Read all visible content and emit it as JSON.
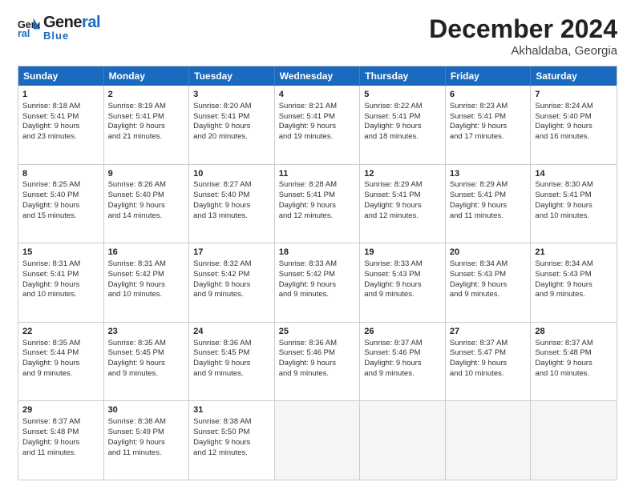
{
  "header": {
    "logo_line1": "General",
    "logo_line2": "Blue",
    "month_title": "December 2024",
    "location": "Akhaldaba, Georgia"
  },
  "days_of_week": [
    "Sunday",
    "Monday",
    "Tuesday",
    "Wednesday",
    "Thursday",
    "Friday",
    "Saturday"
  ],
  "weeks": [
    [
      {
        "day": "1",
        "lines": [
          "Sunrise: 8:18 AM",
          "Sunset: 5:41 PM",
          "Daylight: 9 hours",
          "and 23 minutes."
        ]
      },
      {
        "day": "2",
        "lines": [
          "Sunrise: 8:19 AM",
          "Sunset: 5:41 PM",
          "Daylight: 9 hours",
          "and 21 minutes."
        ]
      },
      {
        "day": "3",
        "lines": [
          "Sunrise: 8:20 AM",
          "Sunset: 5:41 PM",
          "Daylight: 9 hours",
          "and 20 minutes."
        ]
      },
      {
        "day": "4",
        "lines": [
          "Sunrise: 8:21 AM",
          "Sunset: 5:41 PM",
          "Daylight: 9 hours",
          "and 19 minutes."
        ]
      },
      {
        "day": "5",
        "lines": [
          "Sunrise: 8:22 AM",
          "Sunset: 5:41 PM",
          "Daylight: 9 hours",
          "and 18 minutes."
        ]
      },
      {
        "day": "6",
        "lines": [
          "Sunrise: 8:23 AM",
          "Sunset: 5:41 PM",
          "Daylight: 9 hours",
          "and 17 minutes."
        ]
      },
      {
        "day": "7",
        "lines": [
          "Sunrise: 8:24 AM",
          "Sunset: 5:40 PM",
          "Daylight: 9 hours",
          "and 16 minutes."
        ]
      }
    ],
    [
      {
        "day": "8",
        "lines": [
          "Sunrise: 8:25 AM",
          "Sunset: 5:40 PM",
          "Daylight: 9 hours",
          "and 15 minutes."
        ]
      },
      {
        "day": "9",
        "lines": [
          "Sunrise: 8:26 AM",
          "Sunset: 5:40 PM",
          "Daylight: 9 hours",
          "and 14 minutes."
        ]
      },
      {
        "day": "10",
        "lines": [
          "Sunrise: 8:27 AM",
          "Sunset: 5:40 PM",
          "Daylight: 9 hours",
          "and 13 minutes."
        ]
      },
      {
        "day": "11",
        "lines": [
          "Sunrise: 8:28 AM",
          "Sunset: 5:41 PM",
          "Daylight: 9 hours",
          "and 12 minutes."
        ]
      },
      {
        "day": "12",
        "lines": [
          "Sunrise: 8:29 AM",
          "Sunset: 5:41 PM",
          "Daylight: 9 hours",
          "and 12 minutes."
        ]
      },
      {
        "day": "13",
        "lines": [
          "Sunrise: 8:29 AM",
          "Sunset: 5:41 PM",
          "Daylight: 9 hours",
          "and 11 minutes."
        ]
      },
      {
        "day": "14",
        "lines": [
          "Sunrise: 8:30 AM",
          "Sunset: 5:41 PM",
          "Daylight: 9 hours",
          "and 10 minutes."
        ]
      }
    ],
    [
      {
        "day": "15",
        "lines": [
          "Sunrise: 8:31 AM",
          "Sunset: 5:41 PM",
          "Daylight: 9 hours",
          "and 10 minutes."
        ]
      },
      {
        "day": "16",
        "lines": [
          "Sunrise: 8:31 AM",
          "Sunset: 5:42 PM",
          "Daylight: 9 hours",
          "and 10 minutes."
        ]
      },
      {
        "day": "17",
        "lines": [
          "Sunrise: 8:32 AM",
          "Sunset: 5:42 PM",
          "Daylight: 9 hours",
          "and 9 minutes."
        ]
      },
      {
        "day": "18",
        "lines": [
          "Sunrise: 8:33 AM",
          "Sunset: 5:42 PM",
          "Daylight: 9 hours",
          "and 9 minutes."
        ]
      },
      {
        "day": "19",
        "lines": [
          "Sunrise: 8:33 AM",
          "Sunset: 5:43 PM",
          "Daylight: 9 hours",
          "and 9 minutes."
        ]
      },
      {
        "day": "20",
        "lines": [
          "Sunrise: 8:34 AM",
          "Sunset: 5:43 PM",
          "Daylight: 9 hours",
          "and 9 minutes."
        ]
      },
      {
        "day": "21",
        "lines": [
          "Sunrise: 8:34 AM",
          "Sunset: 5:43 PM",
          "Daylight: 9 hours",
          "and 9 minutes."
        ]
      }
    ],
    [
      {
        "day": "22",
        "lines": [
          "Sunrise: 8:35 AM",
          "Sunset: 5:44 PM",
          "Daylight: 9 hours",
          "and 9 minutes."
        ]
      },
      {
        "day": "23",
        "lines": [
          "Sunrise: 8:35 AM",
          "Sunset: 5:45 PM",
          "Daylight: 9 hours",
          "and 9 minutes."
        ]
      },
      {
        "day": "24",
        "lines": [
          "Sunrise: 8:36 AM",
          "Sunset: 5:45 PM",
          "Daylight: 9 hours",
          "and 9 minutes."
        ]
      },
      {
        "day": "25",
        "lines": [
          "Sunrise: 8:36 AM",
          "Sunset: 5:46 PM",
          "Daylight: 9 hours",
          "and 9 minutes."
        ]
      },
      {
        "day": "26",
        "lines": [
          "Sunrise: 8:37 AM",
          "Sunset: 5:46 PM",
          "Daylight: 9 hours",
          "and 9 minutes."
        ]
      },
      {
        "day": "27",
        "lines": [
          "Sunrise: 8:37 AM",
          "Sunset: 5:47 PM",
          "Daylight: 9 hours",
          "and 10 minutes."
        ]
      },
      {
        "day": "28",
        "lines": [
          "Sunrise: 8:37 AM",
          "Sunset: 5:48 PM",
          "Daylight: 9 hours",
          "and 10 minutes."
        ]
      }
    ],
    [
      {
        "day": "29",
        "lines": [
          "Sunrise: 8:37 AM",
          "Sunset: 5:48 PM",
          "Daylight: 9 hours",
          "and 11 minutes."
        ]
      },
      {
        "day": "30",
        "lines": [
          "Sunrise: 8:38 AM",
          "Sunset: 5:49 PM",
          "Daylight: 9 hours",
          "and 11 minutes."
        ]
      },
      {
        "day": "31",
        "lines": [
          "Sunrise: 8:38 AM",
          "Sunset: 5:50 PM",
          "Daylight: 9 hours",
          "and 12 minutes."
        ]
      },
      null,
      null,
      null,
      null
    ]
  ]
}
